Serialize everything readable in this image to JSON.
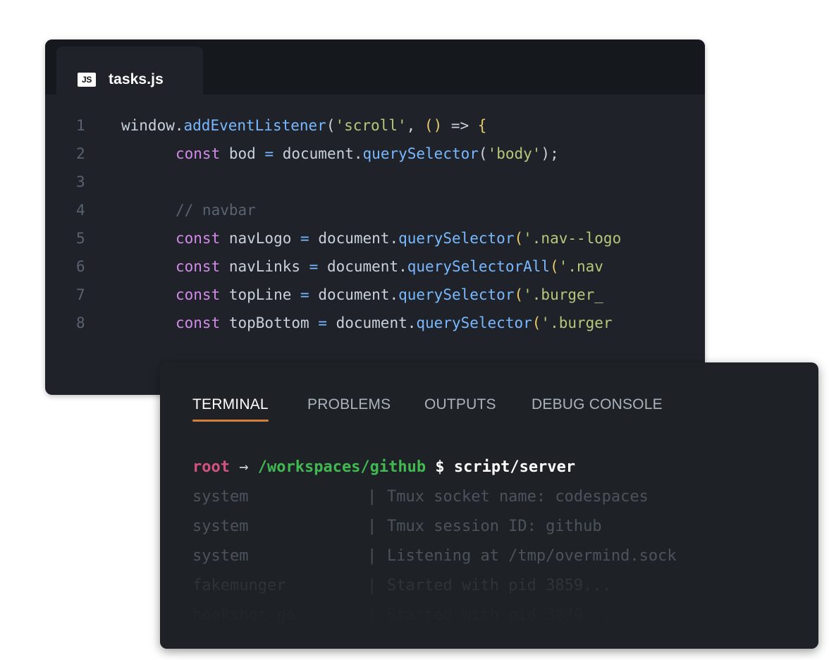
{
  "editor": {
    "tab": {
      "icon_label": "JS",
      "title": "tasks.js"
    },
    "lines": [
      {
        "n": "1",
        "tokens": [
          {
            "t": "window.",
            "c": "#c9d1d9"
          },
          {
            "t": "addEventListener",
            "c": "#79b8ff"
          },
          {
            "t": "(",
            "c": "#c9d1d9"
          },
          {
            "t": "'scroll'",
            "c": "#b5c97a"
          },
          {
            "t": ", ",
            "c": "#c9d1d9"
          },
          {
            "t": "() ",
            "c": "#e8c96b"
          },
          {
            "t": "=> ",
            "c": "#c9d1d9"
          },
          {
            "t": "{",
            "c": "#e8c96b"
          }
        ]
      },
      {
        "n": "2",
        "indent": 1,
        "tokens": [
          {
            "t": "const ",
            "c": "#d38aea"
          },
          {
            "t": "bod ",
            "c": "#c9d1d9"
          },
          {
            "t": "= ",
            "c": "#79b8ff"
          },
          {
            "t": "document.",
            "c": "#c9d1d9"
          },
          {
            "t": "querySelector",
            "c": "#79b8ff"
          },
          {
            "t": "(",
            "c": "#c9d1d9"
          },
          {
            "t": "'body'",
            "c": "#b5c97a"
          },
          {
            "t": ");",
            "c": "#c9d1d9"
          }
        ]
      },
      {
        "n": "3",
        "tokens": []
      },
      {
        "n": "4",
        "indent": 1,
        "tokens": [
          {
            "t": "// navbar",
            "c": "#5b6370"
          }
        ]
      },
      {
        "n": "5",
        "indent": 1,
        "tokens": [
          {
            "t": "const ",
            "c": "#d38aea"
          },
          {
            "t": "navLogo ",
            "c": "#c9d1d9"
          },
          {
            "t": "= ",
            "c": "#79b8ff"
          },
          {
            "t": "document.",
            "c": "#c9d1d9"
          },
          {
            "t": "querySelector",
            "c": "#79b8ff"
          },
          {
            "t": "(",
            "c": "#e8c96b"
          },
          {
            "t": "'.nav--logo",
            "c": "#b5c97a"
          }
        ]
      },
      {
        "n": "6",
        "indent": 1,
        "tokens": [
          {
            "t": "const ",
            "c": "#d38aea"
          },
          {
            "t": "navLinks ",
            "c": "#c9d1d9"
          },
          {
            "t": "= ",
            "c": "#79b8ff"
          },
          {
            "t": "document.",
            "c": "#c9d1d9"
          },
          {
            "t": "querySelectorAll",
            "c": "#79b8ff"
          },
          {
            "t": "(",
            "c": "#e8c96b"
          },
          {
            "t": "'.nav",
            "c": "#b5c97a"
          }
        ]
      },
      {
        "n": "7",
        "indent": 1,
        "tokens": [
          {
            "t": "const ",
            "c": "#d38aea"
          },
          {
            "t": "topLine ",
            "c": "#c9d1d9"
          },
          {
            "t": "= ",
            "c": "#79b8ff"
          },
          {
            "t": "document.",
            "c": "#c9d1d9"
          },
          {
            "t": "querySelector",
            "c": "#79b8ff"
          },
          {
            "t": "(",
            "c": "#e8c96b"
          },
          {
            "t": "'.burger_",
            "c": "#b5c97a"
          }
        ]
      },
      {
        "n": "8",
        "indent": 1,
        "tokens": [
          {
            "t": "const ",
            "c": "#d38aea"
          },
          {
            "t": "topBottom ",
            "c": "#c9d1d9"
          },
          {
            "t": "= ",
            "c": "#79b8ff"
          },
          {
            "t": "document.",
            "c": "#c9d1d9"
          },
          {
            "t": "querySelector",
            "c": "#79b8ff"
          },
          {
            "t": "(",
            "c": "#e8c96b"
          },
          {
            "t": "'.burger",
            "c": "#b5c97a"
          }
        ]
      }
    ]
  },
  "terminal": {
    "tabs": [
      {
        "label": "TERMINAL",
        "active": true
      },
      {
        "label": "PROBLEMS",
        "active": false
      },
      {
        "label": "OUTPUTS",
        "active": false
      },
      {
        "label": "DEBUG CONSOLE",
        "active": false
      }
    ],
    "prompt": {
      "user": "root",
      "arrow": "→",
      "path": "/workspaces/github",
      "symbol": "$",
      "command": "script/server"
    },
    "output": [
      {
        "source": "system",
        "sep": "|",
        "message": "Tmux socket name: codespaces"
      },
      {
        "source": "system",
        "sep": "|",
        "message": "Tmux session ID: github"
      },
      {
        "source": "system",
        "sep": "|",
        "message": "Listening at /tmp/overmind.sock"
      },
      {
        "source": "fakemunger",
        "sep": "|",
        "message": "Started with pid 3859..."
      },
      {
        "source": "hookshot-go",
        "sep": "|",
        "message": "Started with pid 3870..."
      }
    ]
  },
  "colors": {
    "user": "#d2527e",
    "path": "#3fb950",
    "arrow": "#c9d1d9",
    "command": "#ffffff",
    "accent_underline": "#d4803a",
    "output_text": "#4c535c"
  }
}
